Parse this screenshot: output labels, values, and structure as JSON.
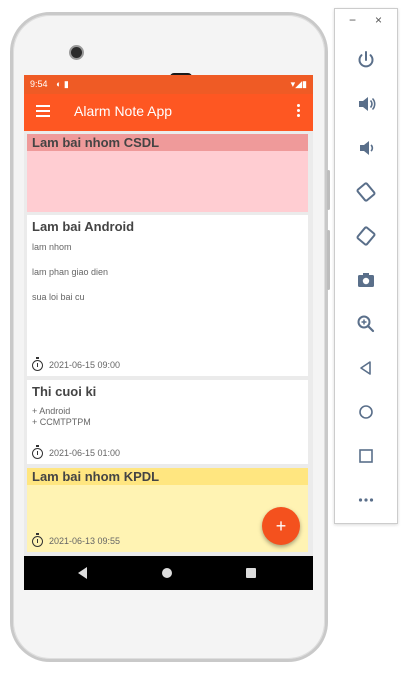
{
  "status_bar": {
    "time": "9:54",
    "left_icons": "◐ ▮",
    "right_icons": "▾◢▮"
  },
  "app_bar": {
    "title": "Alarm Note App"
  },
  "notes": [
    {
      "title": "Lam bai nhom CSDL",
      "lines": [],
      "time": "",
      "color": "#ffcdd2",
      "title_bg": "#ef9a9a"
    },
    {
      "title": "Lam bai Android",
      "lines": [
        "lam nhom",
        "lam phan giao dien",
        "sua loi bai cu"
      ],
      "time": "2021-06-15 09:00",
      "color": "#ffffff",
      "title_bg": ""
    },
    {
      "title": "Thi cuoi ki",
      "lines": [
        "+ Android",
        "+ CCMTPTPM"
      ],
      "time": "2021-06-15 01:00",
      "color": "#ffffff",
      "title_bg": ""
    },
    {
      "title": "Lam bai nhom KPDL",
      "lines": [],
      "time": "2021-06-13 09:55",
      "color": "#fff3b3",
      "title_bg": "#ffe680"
    }
  ],
  "fab": {
    "label": "+"
  },
  "colors": {
    "status_bar": "#ef5b25",
    "app_bar": "#fe5722",
    "fab": "#f4511e"
  },
  "emulator_toolbar": {
    "minimize": "−",
    "close": "×",
    "buttons": [
      "power-icon",
      "volume-up-icon",
      "volume-down-icon",
      "rotate-left-icon",
      "rotate-right-icon",
      "camera-icon",
      "zoom-icon",
      "back-icon",
      "home-icon",
      "overview-icon",
      "more-icon"
    ]
  }
}
